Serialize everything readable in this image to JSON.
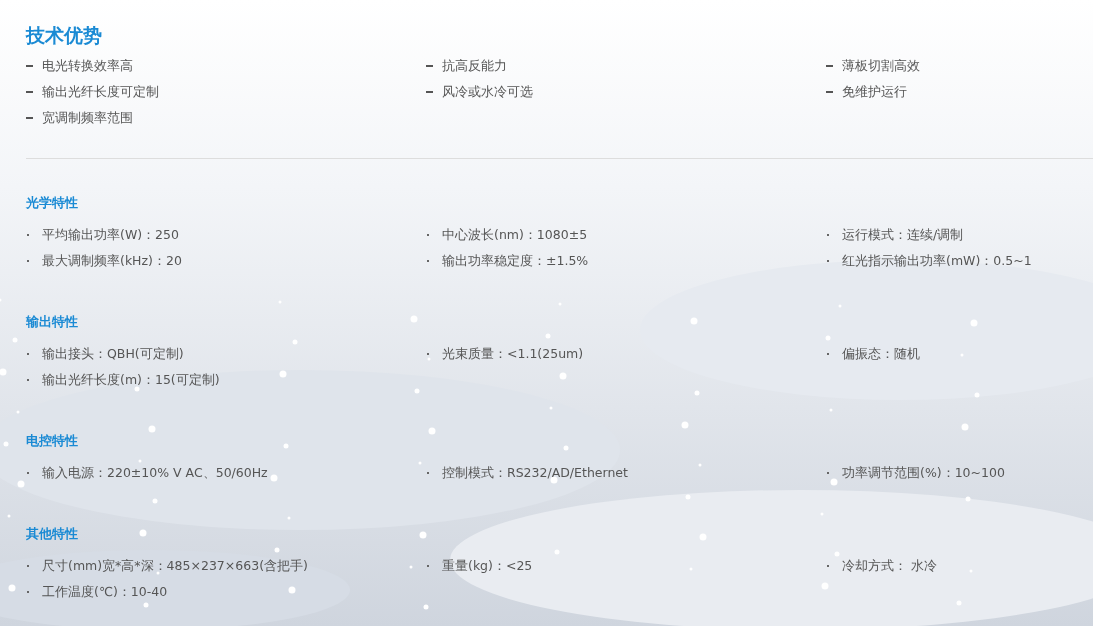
{
  "advantages": {
    "title": "技术优势",
    "items": [
      "电光转换效率高",
      "抗高反能力",
      "薄板切割高效",
      "输出光纤长度可定制",
      "风冷或水冷可选",
      "免维护运行",
      "宽调制频率范围"
    ]
  },
  "sections": [
    {
      "title": "光学特性",
      "items": [
        "平均输出功率(W)：250",
        "中心波长(nm)：1080±5",
        "运行模式：连续/调制",
        "最大调制频率(kHz)：20",
        "输出功率稳定度：±1.5%",
        "红光指示输出功率(mW)：0.5~1"
      ]
    },
    {
      "title": "输出特性",
      "items": [
        "输出接头：QBH(可定制)",
        "光束质量：<1.1(25um)",
        "偏振态：随机",
        "输出光纤长度(m)：15(可定制)"
      ]
    },
    {
      "title": "电控特性",
      "items": [
        "输入电源：220±10% V AC、50/60Hz",
        "控制模式：RS232/AD/Ethernet",
        "功率调节范围(%)：10~100"
      ]
    },
    {
      "title": "其他特性",
      "items": [
        "尺寸(mm)宽*高*深：485×237×663(含把手)",
        "重量(kg)：<25",
        "冷却方式： 水冷",
        "工作温度(℃)：10-40"
      ]
    }
  ]
}
